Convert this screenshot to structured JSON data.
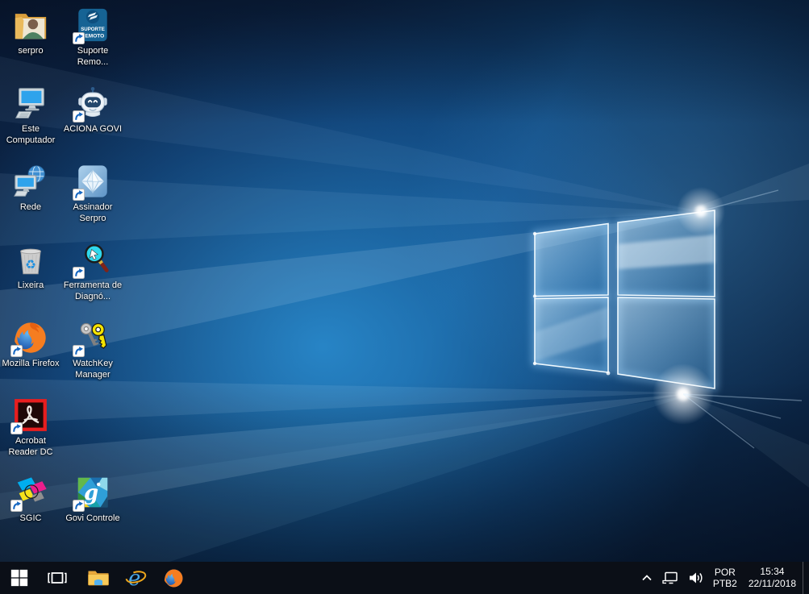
{
  "desktop_icons": [
    {
      "name": "serpro",
      "label": "serpro",
      "icon": "user-folder-icon",
      "shortcut": false
    },
    {
      "name": "suporte-remoto",
      "label": "Suporte Remo...",
      "icon": "suporte-remoto-icon",
      "shortcut": true,
      "icon_text": [
        "SUPORTE",
        "REMOTO"
      ]
    },
    {
      "name": "este-computador",
      "label": "Este Computador",
      "icon": "computer-icon",
      "shortcut": false
    },
    {
      "name": "aciona-govi",
      "label": "ACIONA GOVI",
      "icon": "robot-icon",
      "shortcut": true
    },
    {
      "name": "rede",
      "label": "Rede",
      "icon": "network-globe-icon",
      "shortcut": false
    },
    {
      "name": "assinador-serpro",
      "label": "Assinador Serpro",
      "icon": "diamond-icon",
      "shortcut": true
    },
    {
      "name": "lixeira",
      "label": "Lixeira",
      "icon": "recycle-bin-icon",
      "shortcut": false
    },
    {
      "name": "ferramenta-de-diagnostico",
      "label": "Ferramenta de Diagnó...",
      "icon": "magnifier-icon",
      "shortcut": true
    },
    {
      "name": "mozilla-firefox",
      "label": "Mozilla Firefox",
      "icon": "firefox-icon",
      "shortcut": true
    },
    {
      "name": "watchkey-manager",
      "label": "WatchKey Manager",
      "icon": "keys-icon",
      "shortcut": true
    },
    {
      "name": "acrobat-reader-dc",
      "label": "Acrobat Reader DC",
      "icon": "acrobat-icon",
      "shortcut": true
    },
    {
      "name": "sgic",
      "label": "SGIC",
      "icon": "sgic-icon",
      "shortcut": true
    },
    {
      "name": "govi-controle",
      "label": "Govi Controle",
      "icon": "govi-icon",
      "shortcut": true,
      "icon_letter": "g"
    }
  ],
  "taskbar": {
    "buttons": [
      {
        "name": "start",
        "icon": "windows-logo-icon"
      },
      {
        "name": "task-view",
        "icon": "task-view-icon"
      },
      {
        "name": "file-explorer",
        "icon": "folder-icon"
      },
      {
        "name": "internet-explorer",
        "icon": "ie-icon",
        "glyph_letter": "e"
      },
      {
        "name": "firefox",
        "icon": "firefox-icon"
      }
    ],
    "tray": {
      "icons": [
        "hidden-icons-chevron",
        "network",
        "volume"
      ],
      "language_code": "POR",
      "keyboard_layout": "PTB2",
      "time": "15:34",
      "date": "22/11/2018"
    }
  },
  "colors": {
    "taskbar_bg": "#0b0f17",
    "wallpaper_bright": "#2d96dc",
    "wallpaper_dark": "#0a1c36",
    "logo_glow": "#eaf6ff",
    "shortcut_arrow": "#1566c0",
    "label_text": "#ffffff"
  }
}
